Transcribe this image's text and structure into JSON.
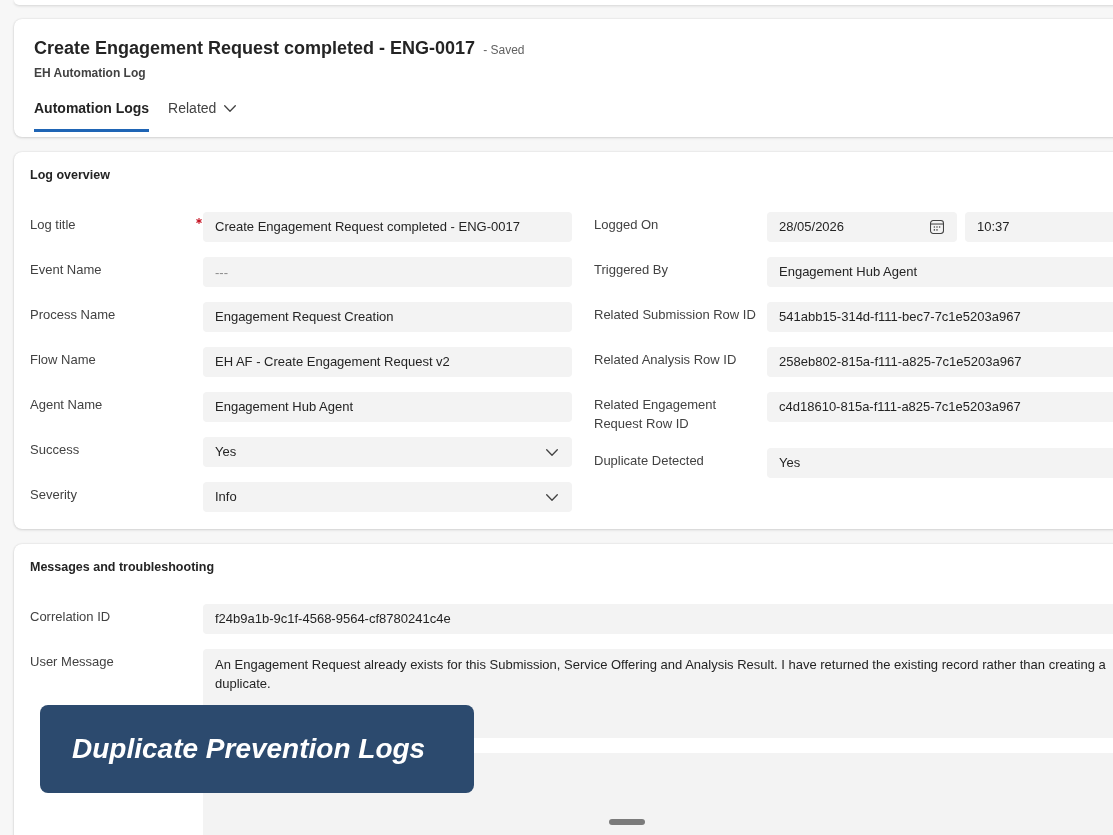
{
  "record": {
    "title": "Create Engagement Request completed - ENG-0017",
    "status": "- Saved",
    "entity": "EH Automation Log"
  },
  "tabs": [
    {
      "label": "Automation Logs",
      "selected": true,
      "kind": "tab"
    },
    {
      "label": "Related",
      "selected": false,
      "kind": "menu"
    }
  ],
  "sections": [
    {
      "title": "Log overview",
      "columns": [
        [
          {
            "label": "Log title",
            "required": true,
            "kind": "text",
            "value": "Create Engagement Request completed - ENG-0017"
          },
          {
            "label": "Event Name",
            "required": false,
            "kind": "text",
            "placeholder": "---"
          },
          {
            "label": "Process Name",
            "required": false,
            "kind": "text",
            "value": "Engagement Request Creation"
          },
          {
            "label": "Flow Name",
            "required": false,
            "kind": "text",
            "value": "EH AF - Create Engagement Request v2"
          },
          {
            "label": "Agent Name",
            "required": false,
            "kind": "text",
            "value": "Engagement Hub Agent"
          },
          {
            "label": "Success",
            "required": false,
            "kind": "select",
            "value": "Yes"
          },
          {
            "label": "Severity",
            "required": false,
            "kind": "select",
            "value": "Info"
          }
        ],
        [
          {
            "label": "Logged On",
            "required": false,
            "kind": "datetime",
            "date": "28/05/2026",
            "time": "10:37"
          },
          {
            "label": "Triggered By",
            "required": false,
            "kind": "text",
            "value": "Engagement Hub Agent"
          },
          {
            "label": "Related Submission Row ID",
            "required": false,
            "kind": "text",
            "value": "541abb15-314d-f111-bec7-7c1e5203a967"
          },
          {
            "label": "Related Analysis Row ID",
            "required": false,
            "kind": "text",
            "value": "258eb802-815a-f111-a825-7c1e5203a967"
          },
          {
            "label": "Related Engagement Request Row ID",
            "required": false,
            "kind": "text",
            "value": "c4d18610-815a-f111-a825-7c1e5203a967"
          },
          {
            "label": "Duplicate Detected",
            "required": false,
            "kind": "text",
            "value": "Yes"
          }
        ]
      ]
    },
    {
      "title": "Messages and troubleshooting",
      "fields": [
        {
          "label": "Correlation ID",
          "required": false,
          "kind": "text",
          "value": "f24b9a1b-9c1f-4568-9564-cf8780241c4e"
        },
        {
          "label": "User Message",
          "required": false,
          "kind": "textarea",
          "value": "An Engagement Request already exists for this Submission, Service Offering and Analysis Result. I have returned the existing record rather than creating a duplicate."
        },
        {
          "kind": "textarea"
        }
      ]
    }
  ],
  "caption": "Duplicate Prevention Logs"
}
